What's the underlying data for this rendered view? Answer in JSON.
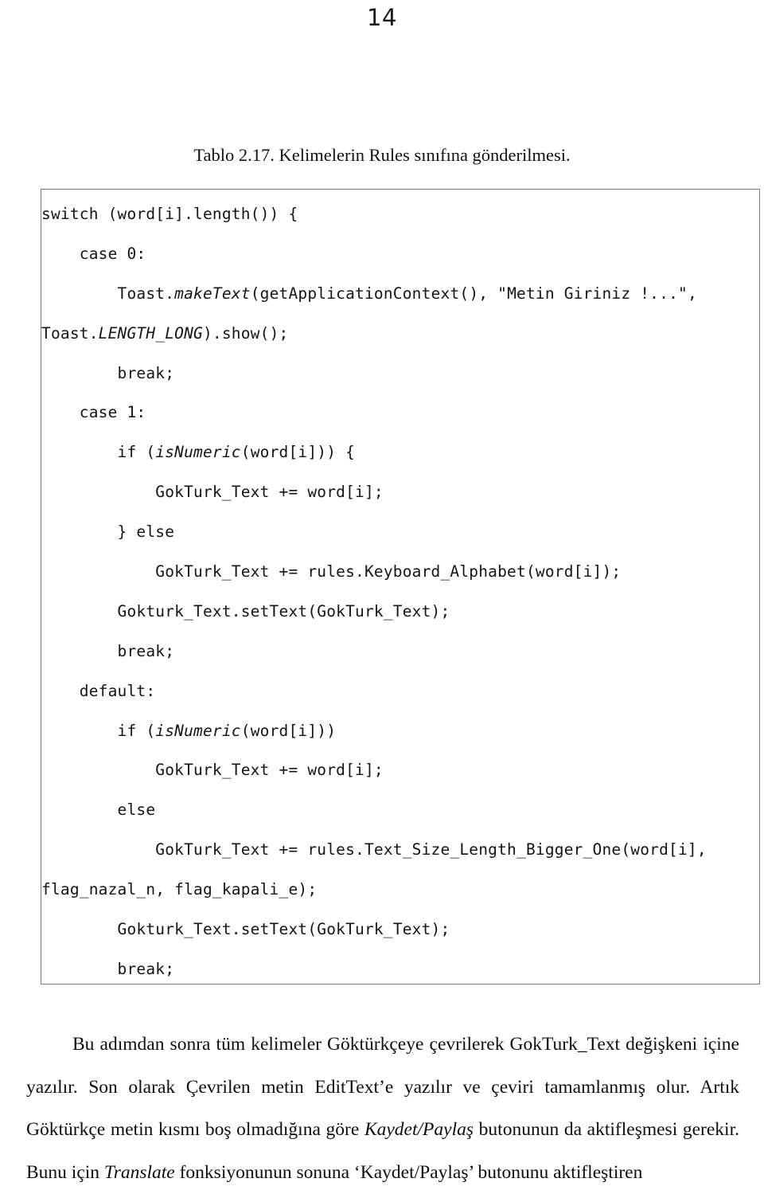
{
  "page": {
    "number": "14"
  },
  "caption": {
    "text": "Tablo 2.17. Kelimelerin Rules sınıfına gönderilmesi."
  },
  "code_block": {
    "language": "java",
    "border_color": "#7b7b7b",
    "lines": [
      "switch (word[i].length()) {",
      "    case 0:",
      "        Toast.<i>makeText</i>(getApplicationContext(), \"Metin Giriniz !...\",",
      "Toast.<i>LENGTH_LONG</i>).show();",
      "        break;",
      "    case 1:",
      "        if (<i>isNumeric</i>(word[i])) {",
      "            GokTurk_Text += word[i];",
      "        } else",
      "            GokTurk_Text += rules.Keyboard_Alphabet(word[i]);",
      "        Gokturk_Text.setText(GokTurk_Text);",
      "        break;",
      "    default:",
      "        if (<i>isNumeric</i>(word[i]))",
      "            GokTurk_Text += word[i];",
      "        else",
      "            GokTurk_Text += rules.Text_Size_Length_Bigger_One(word[i],",
      "flag_nazal_n, flag_kapali_e);",
      "        Gokturk_Text.setText(GokTurk_Text);",
      "        break;",
      "}"
    ],
    "plain_text": "switch (word[i].length()) {\n    case 0:\n        Toast.makeText(getApplicationContext(), \"Metin Giriniz !...\",\nToast.LENGTH_LONG).show();\n        break;\n    case 1:\n        if (isNumeric(word[i])) {\n            GokTurk_Text += word[i];\n        } else\n            GokTurk_Text += rules.Keyboard_Alphabet(word[i]);\n        Gokturk_Text.setText(GokTurk_Text);\n        break;\n    default:\n        if (isNumeric(word[i]))\n            GokTurk_Text += word[i];\n        else\n            GokTurk_Text += rules.Text_Size_Length_Bigger_One(word[i],\nflag_nazal_n, flag_kapali_e);\n        Gokturk_Text.setText(GokTurk_Text);\n        break;\n}"
  },
  "paragraph": {
    "html": "Bu adımdan sonra tüm kelimeler Göktürkçeye çevrilerek GokTurk_Text değişkeni içine yazılır. Son olarak Çevrilen metin EditText’e yazılır ve çeviri tamamlanmış olur. Artık Göktürkçe metin kısmı boş olmadığına göre <i>Kaydet/Paylaş</i> butonunun da aktifleşmesi gerekir. Bunu için <i>Translate</i> fonksiyonunun sonuna ‘Kaydet/Paylaş’ butonunu aktifleştiren",
    "plain_text": "Bu adımdan sonra tüm kelimeler Göktürkçeye çevrilerek GokTurk_Text değişkeni içine yazılır. Son olarak Çevrilen metin EditText’e yazılır ve çeviri tamamlanmış olur. Artık Göktürkçe metin kısmı boş olmadığına göre Kaydet/Paylaş butonunun da aktifleşmesi gerekir. Bunu için Translate fonksiyonunun sonuna ‘Kaydet/Paylaş’ butonunu aktifleştiren"
  }
}
